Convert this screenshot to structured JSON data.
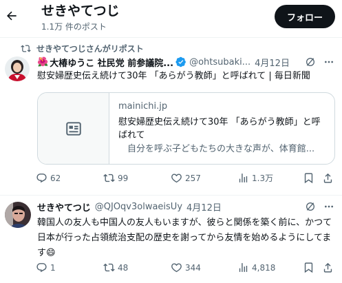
{
  "header": {
    "title": "せきやてつじ",
    "subtitle": "1.1万 件のポスト",
    "follow_label": "フォロー"
  },
  "tweet1": {
    "repost_label": "せきやてつじさんがリポスト",
    "name": "大椿ゆうこ 社民党 前参議院...",
    "name_emoji": "🌺",
    "handle": "@ohtsubaki...",
    "date": "4月12日",
    "text": "慰安婦歴史伝え続けて30年 「あらがう教師」と呼ばれて | 毎日新聞",
    "card": {
      "domain": "mainichi.jp",
      "title": "慰安婦歴史伝え続けて30年 「あらがう教師」と呼ばれて",
      "description": "自分を呼ぶ子どもたちの大きな声が、体育館..."
    },
    "replies": "62",
    "reposts": "99",
    "likes": "257",
    "views": "1.3万"
  },
  "tweet2": {
    "name": "せきやてつじ",
    "handle": "@QJOqv3olwaeisUy",
    "date": "4月12日",
    "text": "韓国人の友人も中国人の友人もいますが、彼らと関係を築く前に、かつて日本が行った占領統治支配の歴史を謝ってから友情を始めるようにしてます😄",
    "replies": "1",
    "reposts": "48",
    "likes": "344",
    "views": "4,818"
  },
  "colors": {
    "text": "#0f1419",
    "secondary": "#536471",
    "verified": "#1d9bf0",
    "follow_bg": "#0f1419",
    "border": "#cfd9de"
  },
  "icons": [
    "back-arrow-icon",
    "repost-icon",
    "verified-icon",
    "grok-icon",
    "more-icon",
    "article-icon",
    "reply-icon",
    "like-icon",
    "views-icon",
    "bookmark-icon",
    "share-icon"
  ]
}
